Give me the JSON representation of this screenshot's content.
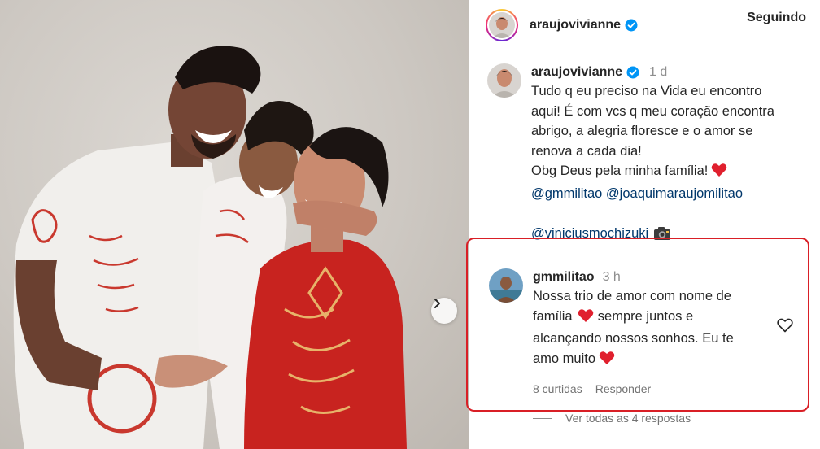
{
  "post": {
    "username": "araujovivianne",
    "follow_label": "Seguindo",
    "caption": {
      "username": "araujovivianne",
      "time": "1 d",
      "text_lines": [
        "Tudo q eu preciso na Vida eu encontro",
        "aqui! É com vcs q meu coração encontra",
        "abrigo, a alegria floresce e o amor se",
        "renova a cada dia!",
        "Obg Deus pela minha família!"
      ],
      "mentions_line": "@gmmilitao @joaquimaraujomilitao",
      "credit_mention": "@viniciusmochizuki"
    },
    "comment": {
      "username": "gmmilitao",
      "time": "3 h",
      "text_lines": [
        "Nossa trio de amor com nome de",
        "família",
        "sempre juntos e",
        "alcançando nossos sonhos. Eu te",
        "amo muito"
      ],
      "likes": "8 curtidas",
      "reply_label": "Responder"
    },
    "view_replies": "Ver todas as 4 respostas"
  },
  "colors": {
    "highlight_box": "#d91f26",
    "verified": "#0095f6",
    "mention": "#00376b",
    "heart": "#e0202e"
  },
  "icons": [
    "verified-badge-icon",
    "red-heart-emoji-icon",
    "camera-emoji-icon",
    "heart-outline-icon",
    "chevron-right-icon"
  ]
}
